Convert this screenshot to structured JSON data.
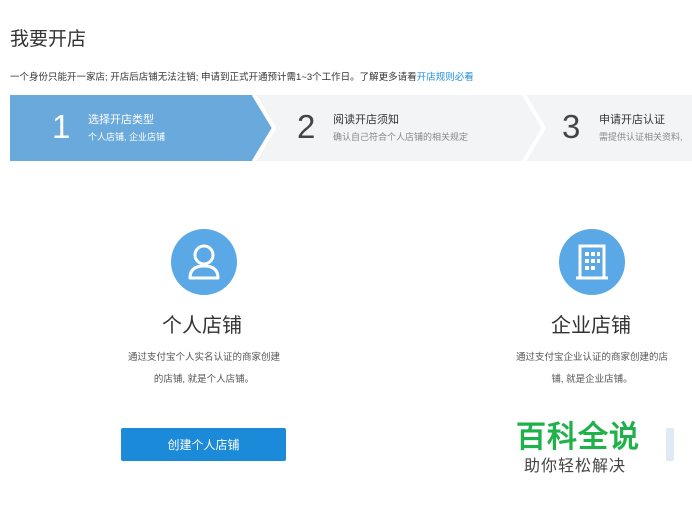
{
  "header": {
    "title": "我要开店",
    "notice_text": "一个身份只能开一家店; 开店后店铺无法注销; 申请到正式开通预计需1~3个工作日。了解更多请看",
    "notice_link": "开店规则必看"
  },
  "steps": [
    {
      "number": "1",
      "title": "选择开店类型",
      "desc": "个人店铺, 企业店铺",
      "state": "active"
    },
    {
      "number": "2",
      "title": "阅读开店须知",
      "desc": "确认自己符合个人店铺的相关规定",
      "state": "inactive"
    },
    {
      "number": "3",
      "title": "申请开店认证",
      "desc": "需提供认证相关资料,",
      "state": "inactive"
    }
  ],
  "options": {
    "personal": {
      "title": "个人店铺",
      "desc_line1": "通过支付宝个人实名认证的商家创建",
      "desc_line2": "的店铺, 就是个人店铺。",
      "button": "创建个人店铺",
      "icon": "user-icon"
    },
    "enterprise": {
      "title": "企业店铺",
      "desc_line1": "通过支付宝企业认证的商家创建的店",
      "desc_line2": "铺, 就是企业店铺。",
      "icon": "building-icon"
    }
  },
  "watermark": {
    "title": "百科全说",
    "subtitle": "助你轻松解决"
  },
  "colors": {
    "active_step": "#6aa9dc",
    "inactive_step": "#f2f4f6",
    "icon_bg": "#5aa9e6",
    "button": "#1b8ad8",
    "link": "#1e8ed9",
    "watermark": "#1fb14a"
  }
}
